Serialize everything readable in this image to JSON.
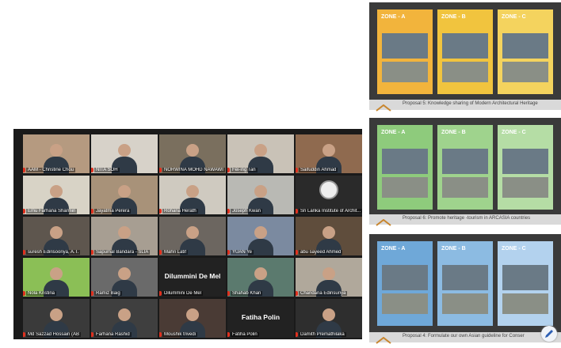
{
  "participants": [
    {
      "name": "AAM - Christine Chou",
      "bg": "#b59a80"
    },
    {
      "name": "NITA SOH",
      "bg": "#d7d2c9"
    },
    {
      "name": "NORWINA MOHD NAWAWI",
      "bg": "#7a6f5e"
    },
    {
      "name": "Fei-ing Tan",
      "bg": "#c9c2b7"
    },
    {
      "name": "Saifuddin Ahmad",
      "bg": "#8f6a4f"
    },
    {
      "name": "Emu Farhana Sharmin",
      "bg": "#d8d3c6"
    },
    {
      "name": "Jayatma Perera",
      "bg": "#a89279"
    },
    {
      "name": "Rohana Herath",
      "bg": "#cfcac0"
    },
    {
      "name": "Joseph Kwan",
      "bg": "#b9b9b4"
    },
    {
      "name": "Sri Lanka Institute of Archit...",
      "bg": "#2a2a2a",
      "logo": true
    },
    {
      "name": "suresh Edirisooriya, A.T.",
      "bg": "#5e564e"
    },
    {
      "name": "Sapumal Bandara - SLIA",
      "bg": "#a79e92"
    },
    {
      "name": "Mahri Latif",
      "bg": "#6c6660"
    },
    {
      "name": "YUAN Ye",
      "bg": "#7b8aa0"
    },
    {
      "name": "abu sayeed Ahmed",
      "bg": "#5f4d3c"
    },
    {
      "name": "Nola Kristina",
      "bg": "#8bbf56"
    },
    {
      "name": "Ramiz Baig",
      "bg": "#6a6a6a"
    },
    {
      "name": "Dilummini De Mel",
      "bg": "#222222",
      "big": "Dilummini De Mel"
    },
    {
      "name": "Shahab Khan",
      "bg": "#5b7a6e"
    },
    {
      "name": "Chandana Edirisuriya",
      "bg": "#b0a89b"
    },
    {
      "name": "Md Sazzad Hossain (AB",
      "bg": "#3a3a3a"
    },
    {
      "name": "Farhana Rashid",
      "bg": "#3f3f3f"
    },
    {
      "name": "Moushik trivedi",
      "bg": "#4a3b35"
    },
    {
      "name": "Fatiha Polin",
      "bg": "#222222",
      "big": "Fatiha Polin"
    },
    {
      "name": "Damith Premathilaka",
      "bg": "#2e2e2e"
    }
  ],
  "slides": [
    {
      "caption": "Proposal 5: Knowledge sharing of Modern Architectural Heritage",
      "zones": [
        {
          "label": "ZONE - A",
          "color": "#f2b43c"
        },
        {
          "label": "ZONE - B",
          "color": "#f1c43e"
        },
        {
          "label": "ZONE - C",
          "color": "#f4d35e"
        }
      ]
    },
    {
      "caption": "Proposal 6: Promote heritage -tourism in ARCASIA countries",
      "zones": [
        {
          "label": "ZONE - A",
          "color": "#8ecb7c"
        },
        {
          "label": "ZONE - B",
          "color": "#9fd38d"
        },
        {
          "label": "ZONE - C",
          "color": "#b5dda5"
        }
      ]
    },
    {
      "caption": "Proposal 4: Formulate our own Asian guideline for Conser",
      "zones": [
        {
          "label": "ZONE - A",
          "color": "#6fa8d8"
        },
        {
          "label": "ZONE - B",
          "color": "#8cbbe2"
        },
        {
          "label": "ZONE - C",
          "color": "#b3d2ee"
        }
      ]
    }
  ],
  "icons": {
    "edit": "pencil-icon"
  }
}
